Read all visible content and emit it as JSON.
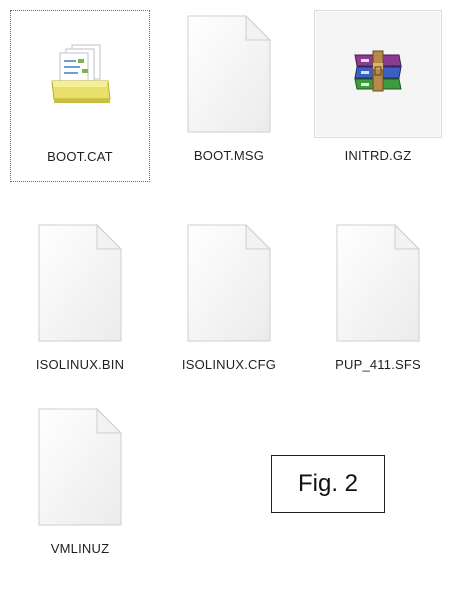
{
  "files": [
    {
      "name": "BOOT.CAT",
      "icon": "catalog-file-icon",
      "selected": true
    },
    {
      "name": "BOOT.MSG",
      "icon": "blank-file-icon",
      "selected": false
    },
    {
      "name": "INITRD.GZ",
      "icon": "winrar-archive-icon",
      "selected": false
    },
    {
      "name": "ISOLINUX.BIN",
      "icon": "blank-file-icon",
      "selected": false
    },
    {
      "name": "ISOLINUX.CFG",
      "icon": "blank-file-icon",
      "selected": false
    },
    {
      "name": "PUP_411.SFS",
      "icon": "blank-file-icon",
      "selected": false
    },
    {
      "name": "VMLINUZ",
      "icon": "blank-file-icon",
      "selected": false
    }
  ],
  "figure_label": "Fig. 2"
}
